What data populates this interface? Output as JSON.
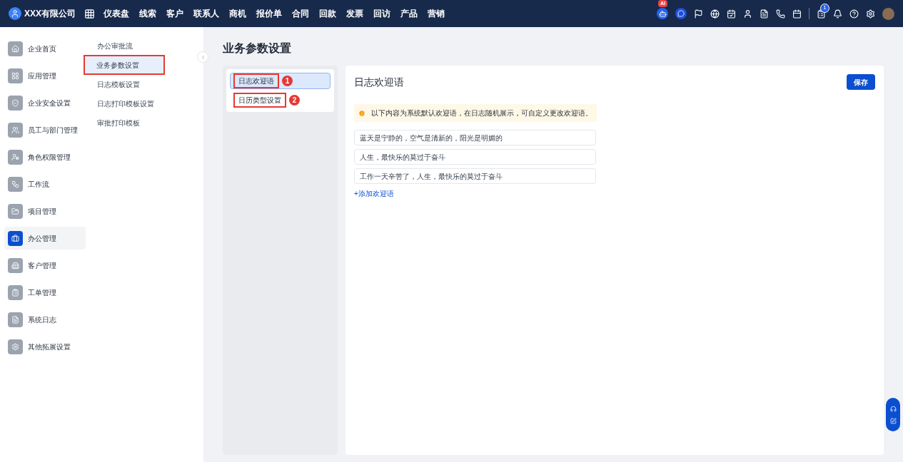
{
  "topbar": {
    "company": "XXX有限公司",
    "nav": [
      "仪表盘",
      "线索",
      "客户",
      "联系人",
      "商机",
      "报价单",
      "合同",
      "回款",
      "发票",
      "回访",
      "产品",
      "营销"
    ],
    "ai_badge": "AI",
    "task_count": "1"
  },
  "sidebar": {
    "items": [
      {
        "label": "企业首页",
        "selected": false
      },
      {
        "label": "应用管理",
        "selected": false
      },
      {
        "label": "企业安全设置",
        "selected": false
      },
      {
        "label": "员工与部门管理",
        "selected": false
      },
      {
        "label": "角色权限管理",
        "selected": false
      },
      {
        "label": "工作流",
        "selected": false
      },
      {
        "label": "项目管理",
        "selected": false
      },
      {
        "label": "办公管理",
        "selected": true
      },
      {
        "label": "客户管理",
        "selected": false
      },
      {
        "label": "工单管理",
        "selected": false
      },
      {
        "label": "系统日志",
        "selected": false
      },
      {
        "label": "其他拓展设置",
        "selected": false
      }
    ]
  },
  "submenu": {
    "items": [
      {
        "label": "办公审批流",
        "selected": false,
        "highlighted": false
      },
      {
        "label": "业务参数设置",
        "selected": true,
        "highlighted": true
      },
      {
        "label": "日志模板设置",
        "selected": false,
        "highlighted": false
      },
      {
        "label": "日志打印模板设置",
        "selected": false,
        "highlighted": false
      },
      {
        "label": "审批打印模板",
        "selected": false,
        "highlighted": false
      }
    ]
  },
  "page_title": "业务参数设置",
  "categories": [
    {
      "label": "日志欢迎语",
      "selected": true,
      "marker": "1"
    },
    {
      "label": "日历类型设置",
      "selected": false,
      "marker": "2"
    }
  ],
  "panel": {
    "title": "日志欢迎语",
    "save": "保存",
    "notice": "以下内容为系统默认欢迎语，在日志随机展示，可自定义更改欢迎语。",
    "greetings": [
      "蓝天是宁静的，空气是清新的，阳光是明媚的",
      "人生，最快乐的莫过于奋斗",
      "工作一天辛苦了，人生，最快乐的莫过于奋斗"
    ],
    "add": "+添加欢迎语"
  }
}
